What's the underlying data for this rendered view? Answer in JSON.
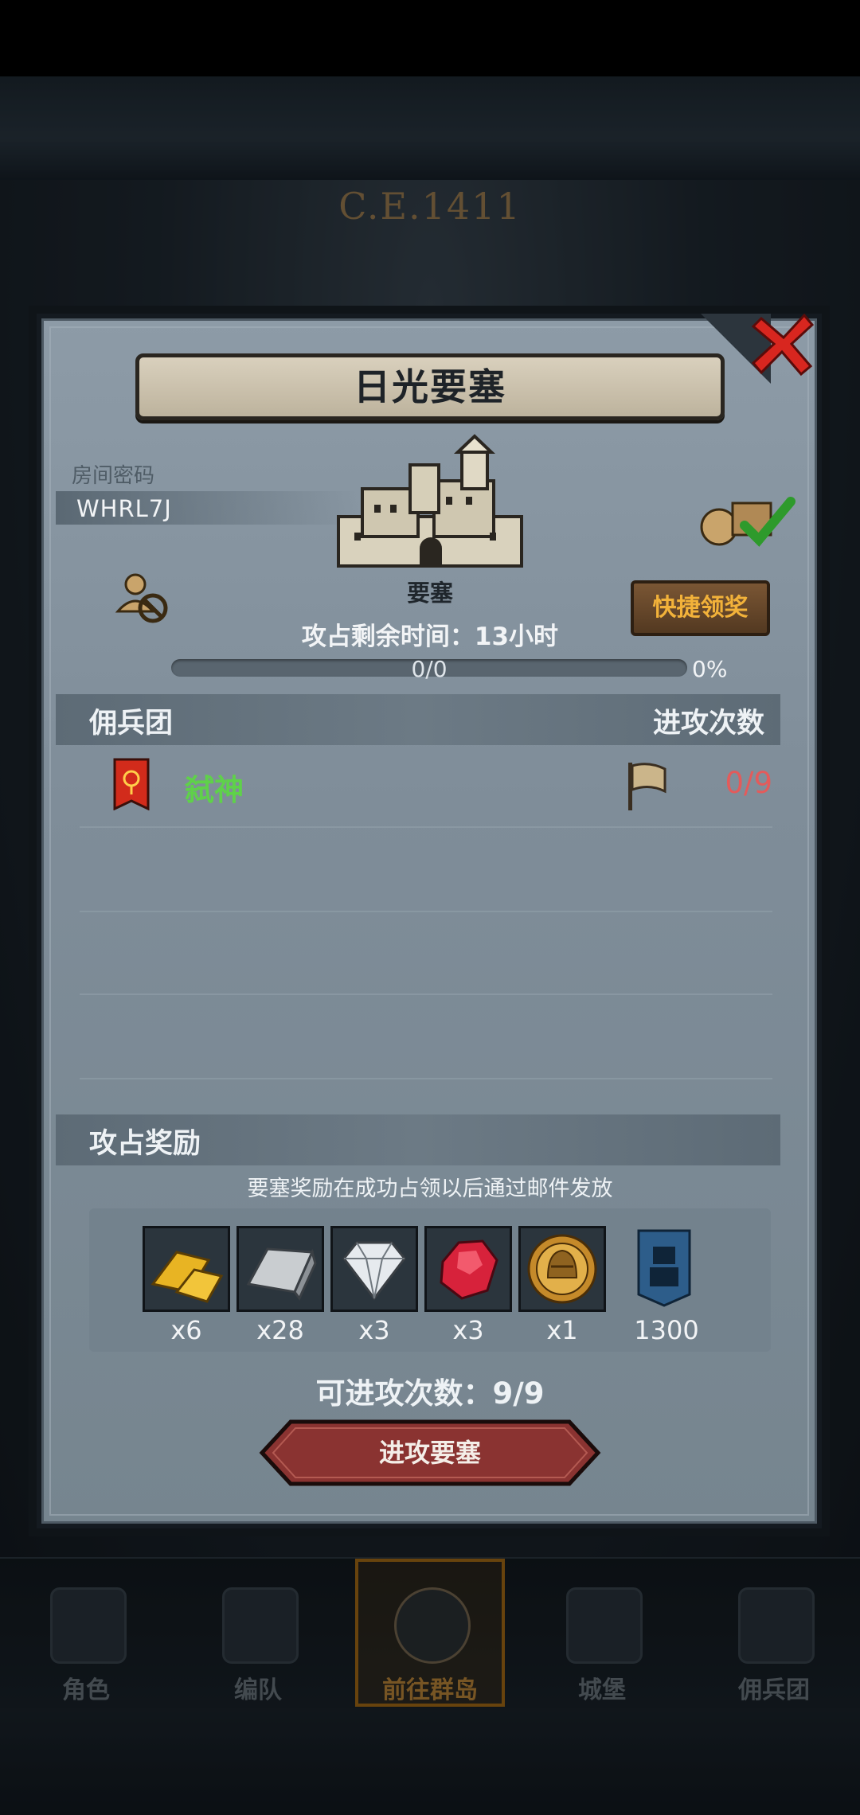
{
  "background": {
    "year": "C.E.1411"
  },
  "dialog": {
    "title": "日光要塞",
    "room_label": "房间密码",
    "room_code": "WHRL7J",
    "fortress_label": "要塞",
    "remaining_time": "攻占剩余时间：13小时",
    "quick_claim_label": "快捷领奖",
    "progress_text": "0/0",
    "progress_percent": "0%",
    "progress_value": 0,
    "mercenary_header": "佣兵团",
    "attack_count_header": "进攻次数",
    "mercenaries": [
      {
        "name": "弑神",
        "attacks": "0/9",
        "name_color": "#5fd14a",
        "attacks_color": "#e35b5b"
      }
    ],
    "reward_header": "攻占奖励",
    "reward_note": "要塞奖励在成功占领以后通过邮件发放",
    "rewards": [
      {
        "icon": "gold-bars-icon",
        "qty": "x6"
      },
      {
        "icon": "iron-ingot-icon",
        "qty": "x28"
      },
      {
        "icon": "diamond-icon",
        "qty": "x3"
      },
      {
        "icon": "ruby-icon",
        "qty": "x3"
      },
      {
        "icon": "knight-medal-icon",
        "qty": "x1"
      },
      {
        "icon": "guild-banner-icon",
        "qty": "1300"
      }
    ],
    "attempts_text": "可进攻次数：9/9",
    "attack_button": "进攻要塞"
  },
  "bottom_nav": [
    {
      "label": "角色",
      "icon": "knight-icon"
    },
    {
      "label": "编队",
      "icon": "helmet-icon"
    },
    {
      "label": "前往群岛",
      "icon": "compass-icon",
      "active": true
    },
    {
      "label": "城堡",
      "icon": "castle-icon"
    },
    {
      "label": "佣兵团",
      "icon": "tower-icon"
    }
  ],
  "colors": {
    "accent": "#d0a44a",
    "merc_name": "#5fd14a",
    "attack_count": "#e35b5b",
    "quick_claim_text": "#f2b23a",
    "attack_button": "#8a3331"
  }
}
